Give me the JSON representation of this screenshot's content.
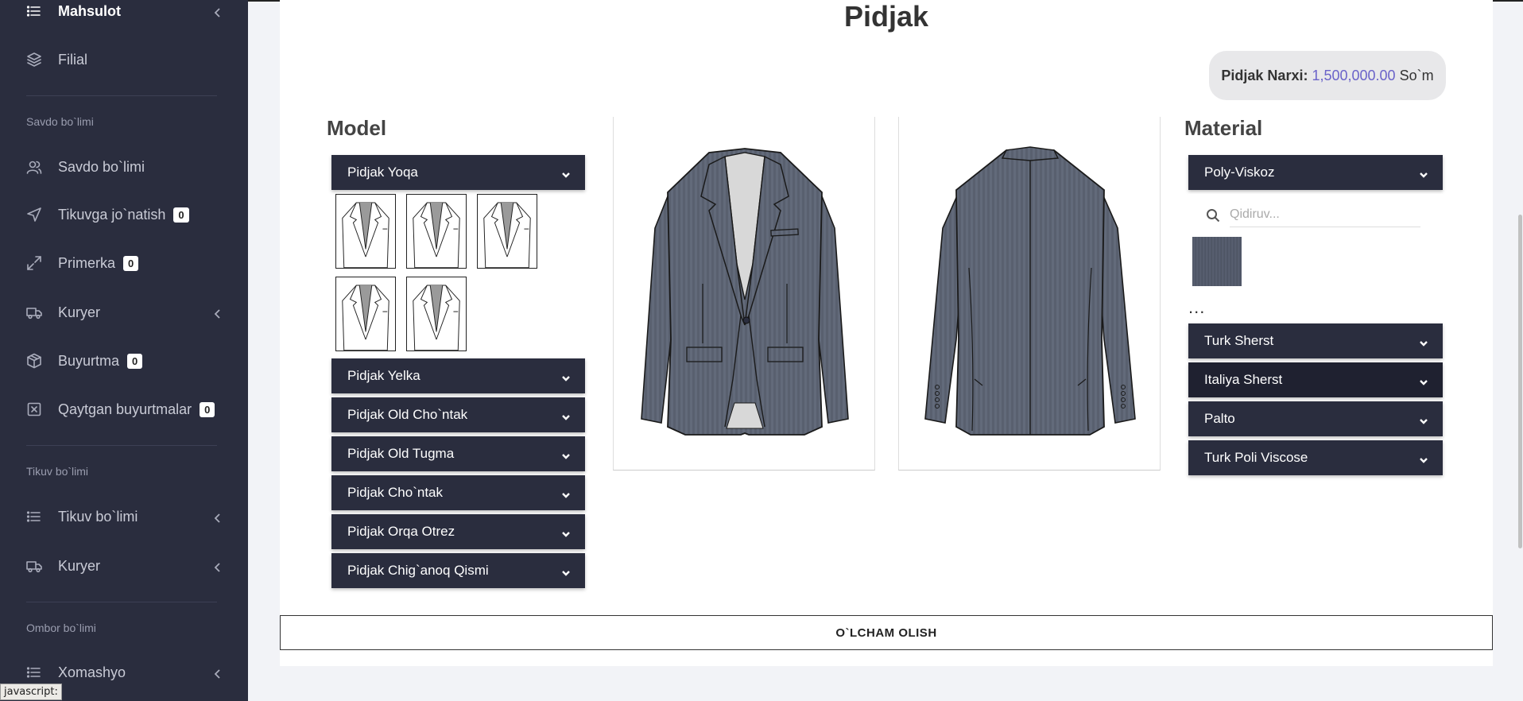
{
  "sidebar": {
    "items": [
      {
        "label": "Mahsulot",
        "icon": "list-icon",
        "has_chevron": true
      },
      {
        "label": "Filial",
        "icon": "layers-icon"
      },
      {
        "label": "Savdo bo`limi",
        "icon": "users-icon"
      },
      {
        "label": "Tikuvga jo`natish",
        "icon": "send-icon",
        "badge": "0"
      },
      {
        "label": "Primerka",
        "icon": "expand-icon",
        "badge": "0"
      },
      {
        "label": "Kuryer",
        "icon": "truck-icon",
        "has_chevron": true
      },
      {
        "label": "Buyurtma",
        "icon": "box-icon",
        "badge": "0"
      },
      {
        "label": "Qaytgan buyurtmalar",
        "icon": "x-square-icon",
        "badge": "0"
      },
      {
        "label": "Tikuv bo`limi",
        "icon": "list-icon",
        "has_chevron": true
      },
      {
        "label": "Kuryer",
        "icon": "truck-icon",
        "has_chevron": true
      },
      {
        "label": "Xomashyo",
        "icon": "list-icon",
        "has_chevron": true
      }
    ],
    "sections": [
      "Savdo bo`limi",
      "Tikuv bo`limi",
      "Ombor bo`limi"
    ]
  },
  "status_tip": "javascript:",
  "main": {
    "title": "Pidjak",
    "price": {
      "label": "Pidjak Narxi:",
      "value": "1,500,000.00",
      "currency": "So`m"
    },
    "model": {
      "title": "Model",
      "accordions": [
        "Pidjak Yoqa",
        "Pidjak Yelka",
        "Pidjak Old Cho`ntak",
        "Pidjak Old Tugma",
        "Pidjak Cho`ntak",
        "Pidjak Orqa Otrez",
        "Pidjak Chig`anoq Qismi"
      ],
      "thumb_count": 5
    },
    "material": {
      "title": "Material",
      "accordions": [
        "Poly-Viskoz",
        "Turk Sherst",
        "Italiya Sherst",
        "Palto",
        "Turk Poli Viscose"
      ],
      "search_placeholder": "Qidiruv...",
      "ellipsis": "..."
    },
    "measure_button": "O`LCHAM OLISH"
  },
  "colors": {
    "sidebar_bg": "#2a2d3e",
    "accent": "#6a63c9",
    "fabric": "#555c6c"
  }
}
